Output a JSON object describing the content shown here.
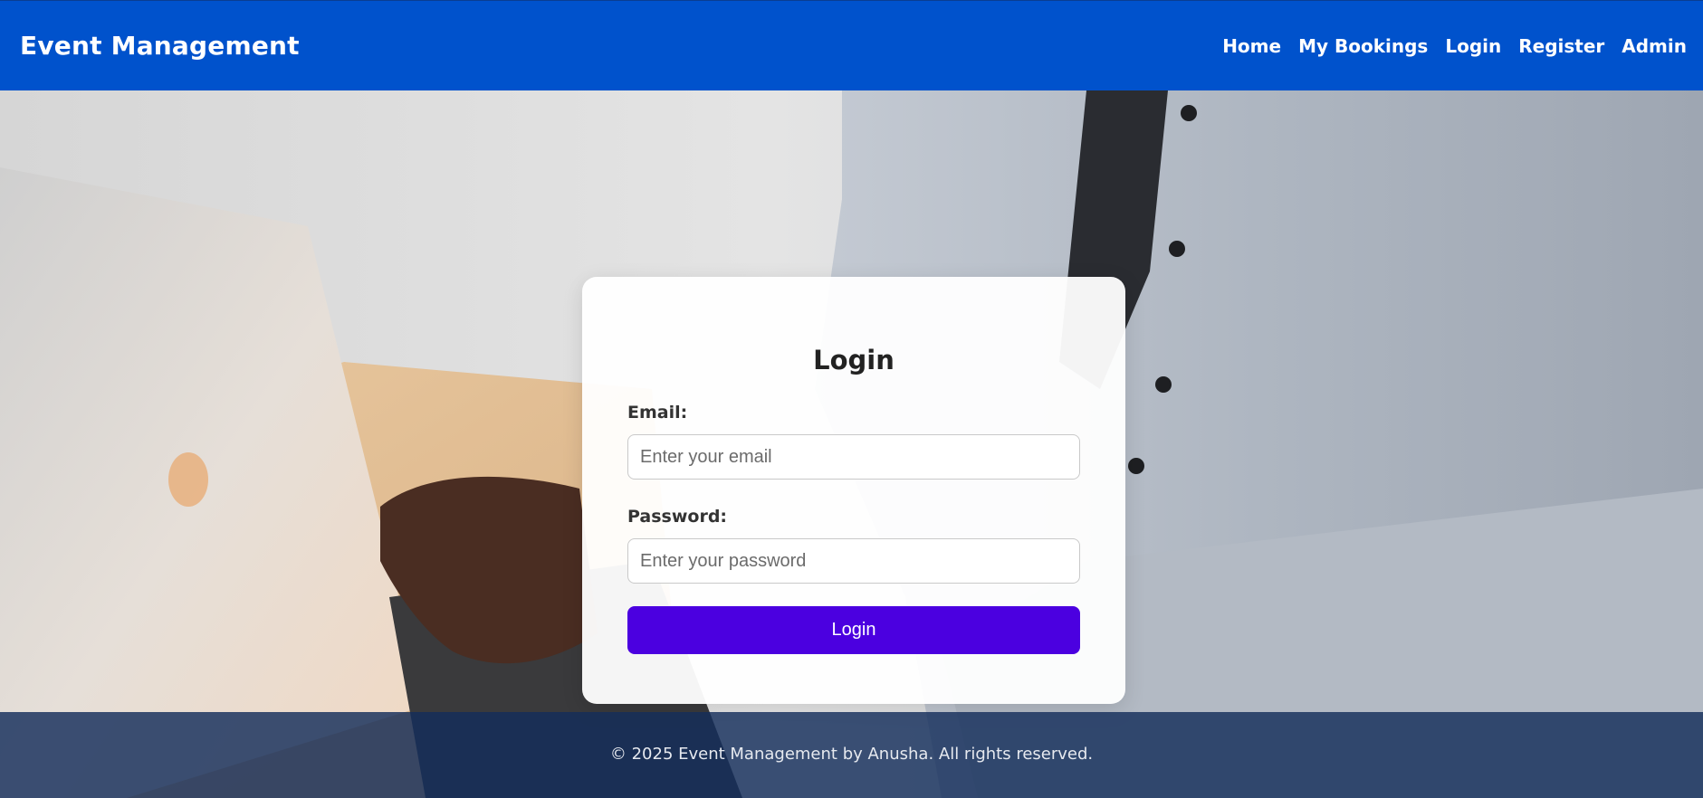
{
  "navbar": {
    "brand": "Event Management",
    "links": [
      {
        "label": "Home"
      },
      {
        "label": "My Bookings"
      },
      {
        "label": "Login"
      },
      {
        "label": "Register"
      },
      {
        "label": "Admin"
      }
    ]
  },
  "login_form": {
    "title": "Login",
    "email_label": "Email:",
    "email_placeholder": "Enter your email",
    "email_value": "",
    "password_label": "Password:",
    "password_placeholder": "Enter your password",
    "password_value": "",
    "submit_label": "Login"
  },
  "footer": {
    "text": "© 2025 Event Management by Anusha. All rights reserved."
  },
  "colors": {
    "navbar_bg": "#0052cc",
    "button_bg": "#4b00e0",
    "footer_bg": "#142d5a"
  },
  "icons": {
    "background_photo": "person-typing-on-laptop-photo"
  }
}
